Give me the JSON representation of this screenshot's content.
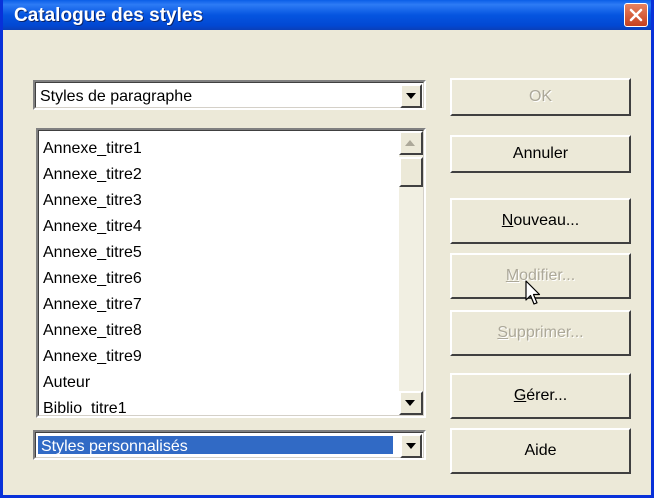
{
  "window": {
    "title": "Catalogue des styles"
  },
  "style_family": {
    "value": "Styles de paragraphe"
  },
  "styles_list": {
    "items": [
      "Annexe_titre1",
      "Annexe_titre2",
      "Annexe_titre3",
      "Annexe_titre4",
      "Annexe_titre5",
      "Annexe_titre6",
      "Annexe_titre7",
      "Annexe_titre8",
      "Annexe_titre9",
      "Auteur",
      "Biblio_titre1"
    ]
  },
  "filter": {
    "value": "Styles personnalisés"
  },
  "buttons": {
    "ok": "OK",
    "cancel": "Annuler",
    "new": "Nouveau...",
    "modify": "Modifier...",
    "delete": "Supprimer...",
    "manage": "Gérer...",
    "help": "Aide"
  },
  "icons": {
    "close": "close-icon",
    "dropdown": "chevron-down-icon",
    "scroll_up": "arrow-up-icon",
    "scroll_down": "arrow-down-icon",
    "cursor": "mouse-pointer-icon"
  },
  "colors": {
    "titlebar": "#0A5EE7",
    "selection": "#316AC5",
    "dialog_bg": "#ECE9D8",
    "disabled_text": "#ACA899"
  }
}
